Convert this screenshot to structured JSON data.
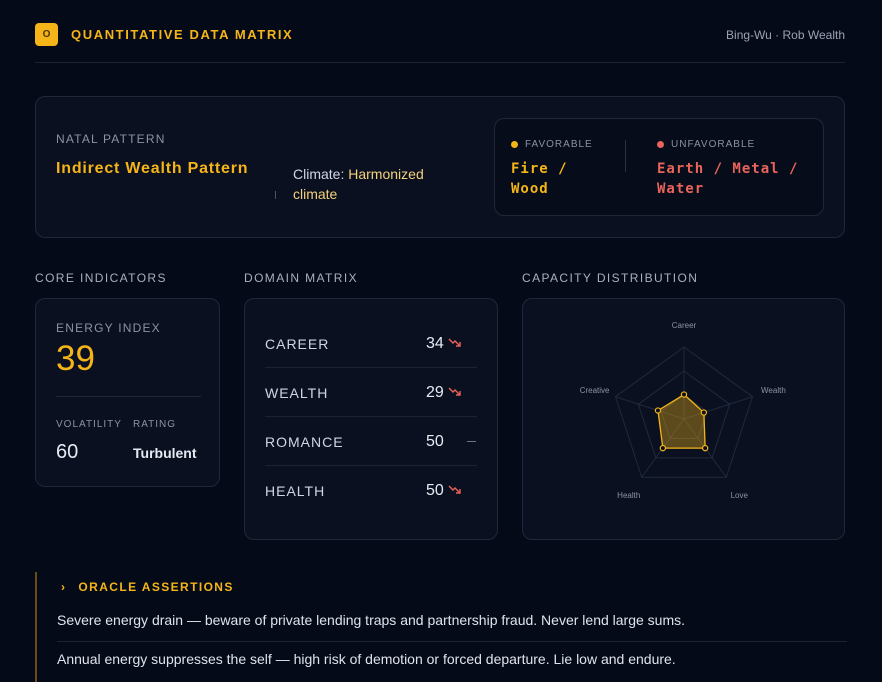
{
  "header": {
    "logo_glyph": "O",
    "title": "QUANTITATIVE DATA MATRIX",
    "brand": "Bing-Wu · Rob Wealth"
  },
  "pattern": {
    "label": "NATAL PATTERN",
    "name": "Indirect Wealth Pattern",
    "climate_label": "Climate:",
    "climate_value": "Harmonized climate",
    "favorable_label": "FAVORABLE",
    "favorable_value": "Fire / Wood",
    "unfavorable_label": "UNFAVORABLE",
    "unfavorable_value": "Earth / Metal / Water",
    "favorable_color": "#f5b518",
    "unfavorable_color": "#e9645a"
  },
  "sections": {
    "core": "CORE INDICATORS",
    "domain": "DOMAIN MATRIX",
    "capacity": "CAPACITY DISTRIBUTION"
  },
  "core": {
    "energy_label": "ENERGY INDEX",
    "energy_value": "39",
    "volatility_label": "VOLATILITY",
    "volatility_value": "60",
    "rating_label": "RATING",
    "rating_value": "Turbulent"
  },
  "domains": [
    {
      "name": "CAREER",
      "value": "34",
      "trend": "down"
    },
    {
      "name": "WEALTH",
      "value": "29",
      "trend": "down"
    },
    {
      "name": "ROMANCE",
      "value": "50",
      "trend": "flat"
    },
    {
      "name": "HEALTH",
      "value": "50",
      "trend": "down"
    }
  ],
  "capacity": {
    "axes": [
      "Career",
      "Wealth",
      "Love",
      "Health",
      "Creative"
    ],
    "values": [
      34,
      29,
      50,
      50,
      38
    ],
    "max": 100,
    "fill_color": "#f5b518"
  },
  "oracle": {
    "title": "ORACLE ASSERTIONS",
    "assertions": [
      "Severe energy drain — beware of private lending traps and partnership fraud. Never lend large sums.",
      "Annual energy suppresses the self — high risk of demotion or forced departure. Lie low and endure."
    ]
  }
}
